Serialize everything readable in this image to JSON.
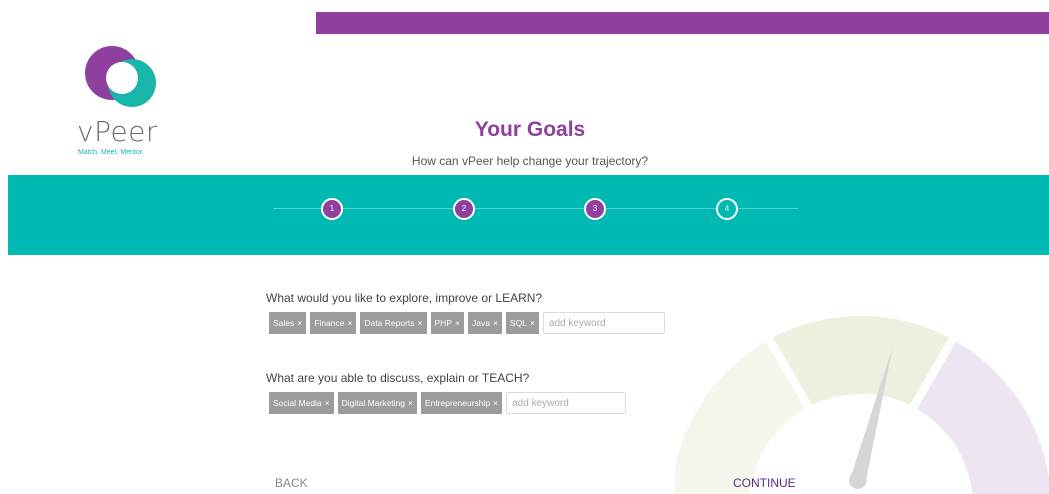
{
  "brand": {
    "name": "vPeer",
    "tagline": "Match. Meet. Mentor.",
    "colors": {
      "purple": "#8f3f9e",
      "teal": "#00b9b2"
    }
  },
  "page": {
    "title": "Your Goals",
    "subtitle": "How can vPeer help change your trajectory?"
  },
  "steps": [
    "1",
    "2",
    "3",
    "4"
  ],
  "learn": {
    "question": "What would you like to explore, improve or LEARN?",
    "tags": [
      "Sales",
      "Finance",
      "Data Reports",
      "PHP",
      "Java",
      "SQL"
    ],
    "remove_glyph": "×",
    "placeholder": "add keyword"
  },
  "teach": {
    "question": "What are you able to discuss, explain or TEACH?",
    "tags": [
      "Social Media",
      "Digital Marketing",
      "Entrepreneurship"
    ],
    "remove_glyph": "×",
    "placeholder": "add keyword"
  },
  "nav": {
    "back_label": "BACK",
    "continue_label": "CONTINUE"
  }
}
